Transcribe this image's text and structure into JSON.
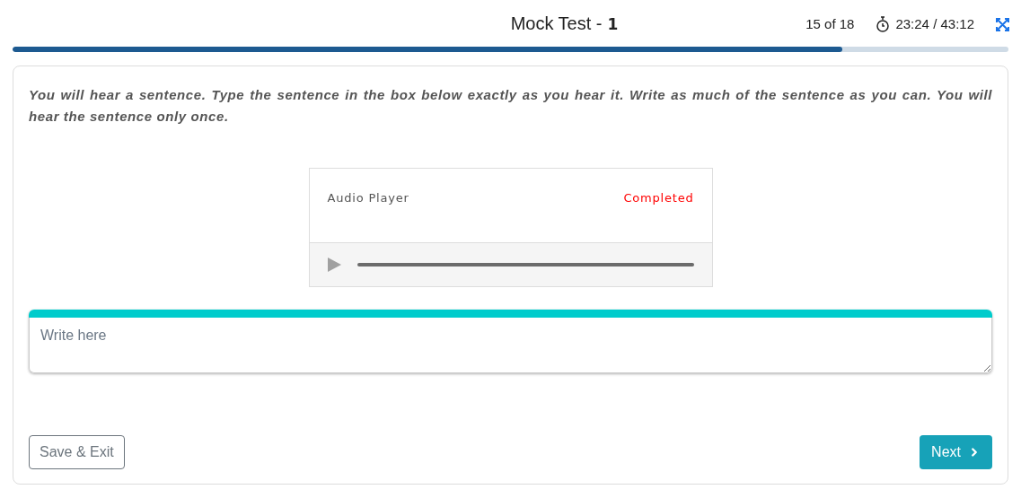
{
  "header": {
    "title": "Mock Test -",
    "test_number": "1",
    "question_counter": "15 of 18",
    "timer": "23:24 / 43:12"
  },
  "progress": {
    "level": 0.833
  },
  "instructions": "You will hear a sentence. Type the sentence in the box below exactly as you hear it. Write as much of the sentence as you can. You will hear the sentence only once.",
  "audio_player": {
    "label": "Audio Player",
    "status": "Completed",
    "completed": true
  },
  "answer": {
    "placeholder": "Write here"
  },
  "buttons": [
    {
      "kind": "outline",
      "label": "Save & Exit"
    },
    {
      "kind": "primary",
      "label": "Next"
    }
  ]
}
